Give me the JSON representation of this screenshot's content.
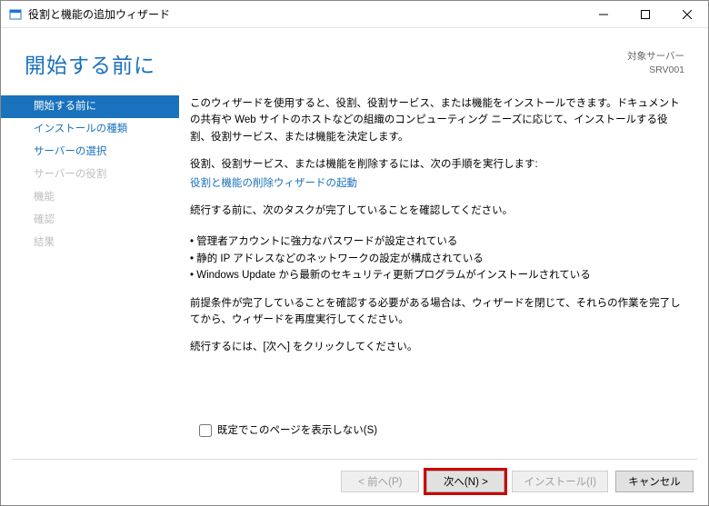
{
  "window": {
    "title": "役割と機能の追加ウィザード"
  },
  "header": {
    "page_title": "開始する前に",
    "server_label": "対象サーバー",
    "server_name": "SRV001"
  },
  "sidebar": {
    "items": [
      {
        "label": "開始する前に",
        "state": "active"
      },
      {
        "label": "インストールの種類",
        "state": "normal"
      },
      {
        "label": "サーバーの選択",
        "state": "normal"
      },
      {
        "label": "サーバーの役割",
        "state": "disabled"
      },
      {
        "label": "機能",
        "state": "disabled"
      },
      {
        "label": "確認",
        "state": "disabled"
      },
      {
        "label": "結果",
        "state": "disabled"
      }
    ]
  },
  "content": {
    "intro": "このウィザードを使用すると、役割、役割サービス、または機能をインストールできます。ドキュメントの共有や Web サイトのホストなどの組織のコンピューティング ニーズに応じて、インストールする役割、役割サービス、または機能を決定します。",
    "remove_label": "役割、役割サービス、または機能を削除するには、次の手順を実行します:",
    "remove_link": "役割と機能の削除ウィザードの起動",
    "tasks_prompt": "続行する前に、次のタスクが完了していることを確認してください。",
    "bullets": [
      "管理者アカウントに強力なパスワードが設定されている",
      "静的 IP アドレスなどのネットワークの設定が構成されている",
      "Windows Update から最新のセキュリティ更新プログラムがインストールされている"
    ],
    "prereq": "前提条件が完了していることを確認する必要がある場合は、ウィザードを閉じて、それらの作業を完了してから、ウィザードを再度実行してください。",
    "continue_hint": "続行するには、[次へ] をクリックしてください。",
    "skip_label": "既定でこのページを表示しない(S)"
  },
  "footer": {
    "prev": "< 前へ(P)",
    "next": "次へ(N) >",
    "install": "インストール(I)",
    "cancel": "キャンセル"
  }
}
